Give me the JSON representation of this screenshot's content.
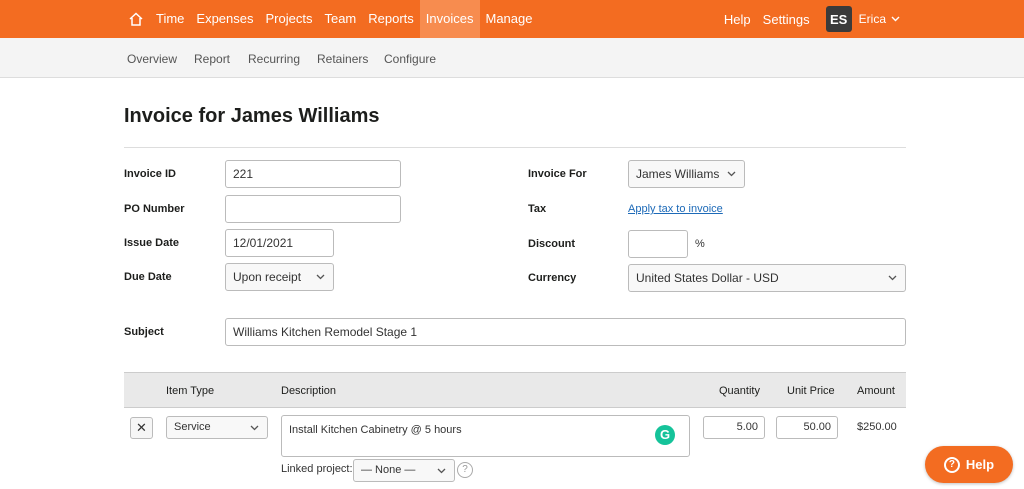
{
  "nav": {
    "items": [
      "Time",
      "Expenses",
      "Projects",
      "Team",
      "Reports",
      "Invoices",
      "Manage"
    ],
    "active": "Invoices",
    "help": "Help",
    "settings": "Settings",
    "avatar_initials": "ES",
    "user_name": "Erica",
    "brand_color": "#f36c21"
  },
  "subnav": [
    "Overview",
    "Report",
    "Recurring",
    "Retainers",
    "Configure"
  ],
  "page": {
    "title": "Invoice for James Williams"
  },
  "form": {
    "invoice_id_label": "Invoice ID",
    "invoice_id_value": "221",
    "po_label": "PO Number",
    "po_value": "",
    "issue_label": "Issue Date",
    "issue_value": "12/01/2021",
    "due_label": "Due Date",
    "due_value": "Upon receipt",
    "for_label": "Invoice For",
    "for_value": "James Williams",
    "tax_label": "Tax",
    "tax_link": "Apply tax to invoice",
    "discount_label": "Discount",
    "discount_value": "",
    "discount_unit": "%",
    "currency_label": "Currency",
    "currency_value": "United States Dollar - USD",
    "subject_label": "Subject",
    "subject_value": "Williams Kitchen Remodel Stage 1"
  },
  "table": {
    "headers": {
      "item_type": "Item Type",
      "description": "Description",
      "quantity": "Quantity",
      "unit_price": "Unit Price",
      "amount": "Amount"
    },
    "rows": [
      {
        "remove": "✕",
        "item_type": "Service",
        "description": "Install Kitchen Cabinetry @ 5 hours",
        "quantity": "5.00",
        "unit_price": "50.00",
        "amount": "$250.00",
        "linked_label": "Linked project:",
        "linked_value": "— None —"
      }
    ]
  },
  "help_button": "Help",
  "grammarly_icon": "G"
}
